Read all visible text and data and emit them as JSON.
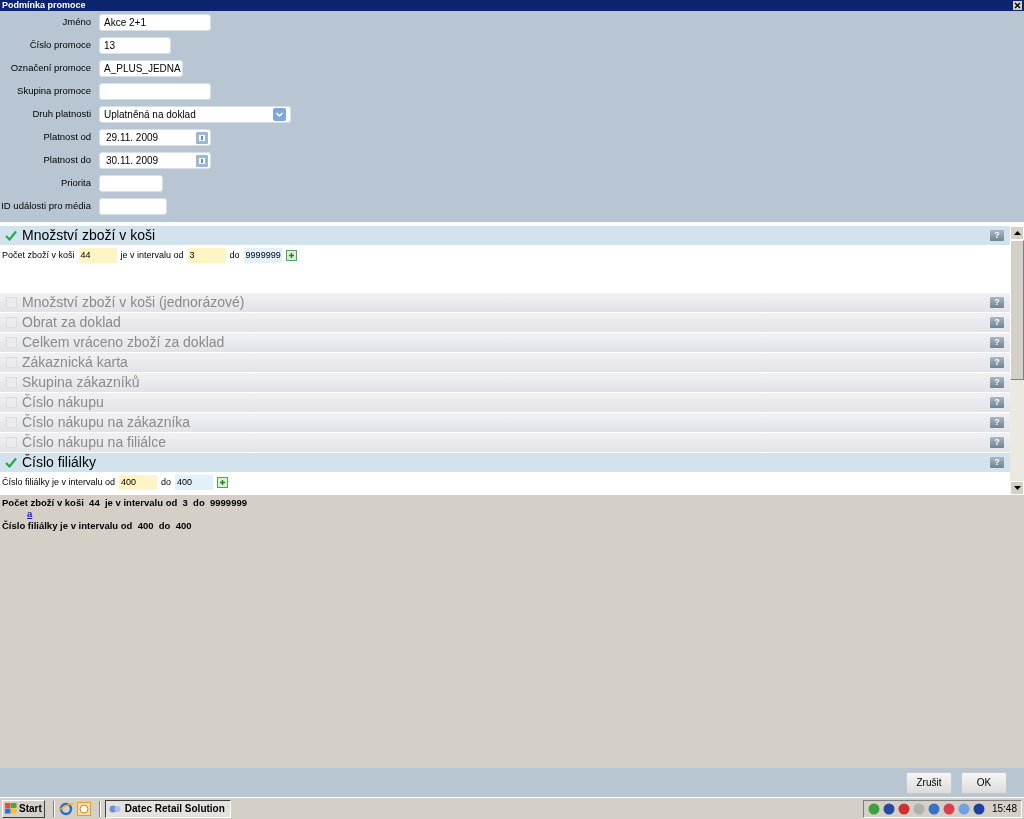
{
  "window": {
    "title": "Podmínka promoce"
  },
  "fields": [
    {
      "label": "Jméno",
      "kind": "text",
      "value": "Akce 2+1"
    },
    {
      "label": "Číslo promoce",
      "kind": "text",
      "value": "13"
    },
    {
      "label": "Označení promoce",
      "kind": "text",
      "value": "A_PLUS_JEDNA"
    },
    {
      "label": "Skupina promoce",
      "kind": "text"
    },
    {
      "label": "Druh platnosti",
      "kind": "select",
      "value": "Uplatněná na doklad"
    },
    {
      "label": "Platnost od",
      "kind": "date",
      "value": "29.11. 2009"
    },
    {
      "label": "Platnost do",
      "kind": "date",
      "value": "30.11. 2009"
    },
    {
      "label": "Priorita",
      "kind": "text"
    },
    {
      "label": "ID události pro média",
      "kind": "text"
    }
  ],
  "conditions": [
    {
      "title": "Množství zboží v koši",
      "checked": true,
      "expression": [
        {
          "kind": "label",
          "text": "Počet zboží v koši"
        },
        {
          "kind": "value",
          "text": "44",
          "color": "#fff4c4"
        },
        {
          "kind": "label",
          "text": "je v intervalu od"
        },
        {
          "kind": "value",
          "text": "3",
          "color": "#fff4c4"
        },
        {
          "kind": "label",
          "text": "do"
        },
        {
          "kind": "value",
          "text": "9999999",
          "color": "#e2f0fa"
        }
      ]
    },
    {
      "title": "Množství zboží v koši (jednorázové)",
      "checked": false
    },
    {
      "title": "Obrat za doklad",
      "checked": false
    },
    {
      "title": "Celkem vráceno zboží za doklad",
      "checked": false
    },
    {
      "title": "Zákaznická karta",
      "checked": false
    },
    {
      "title": "Skupina zákazníků",
      "checked": false
    },
    {
      "title": "Číslo nákupu",
      "checked": false
    },
    {
      "title": "Číslo nákupu na zákazníka",
      "checked": false
    },
    {
      "title": "Číslo nákupu na filiálce",
      "checked": false
    },
    {
      "title": "Číslo filiálky",
      "checked": true,
      "expression": [
        {
          "kind": "label",
          "text": "Číslo filiálky je v intervalu od"
        },
        {
          "kind": "value",
          "text": "400",
          "color": "#fff4c4"
        },
        {
          "kind": "label",
          "text": "do"
        },
        {
          "kind": "value",
          "text": "400",
          "color": "#e2f0fa"
        }
      ]
    }
  ],
  "help_label": "?",
  "summary": [
    {
      "text": "Počet zboží v koši  44  je v intervalu od  3  do  9999999"
    },
    {
      "link": "a",
      "text": "Číslo filiálky je v intervalu od  400  do  400"
    }
  ],
  "buttons": [
    "Zrušit",
    "OK"
  ],
  "taskbar": {
    "start": "Start",
    "window": "Datec Retail Solution",
    "clock": "15:48"
  }
}
